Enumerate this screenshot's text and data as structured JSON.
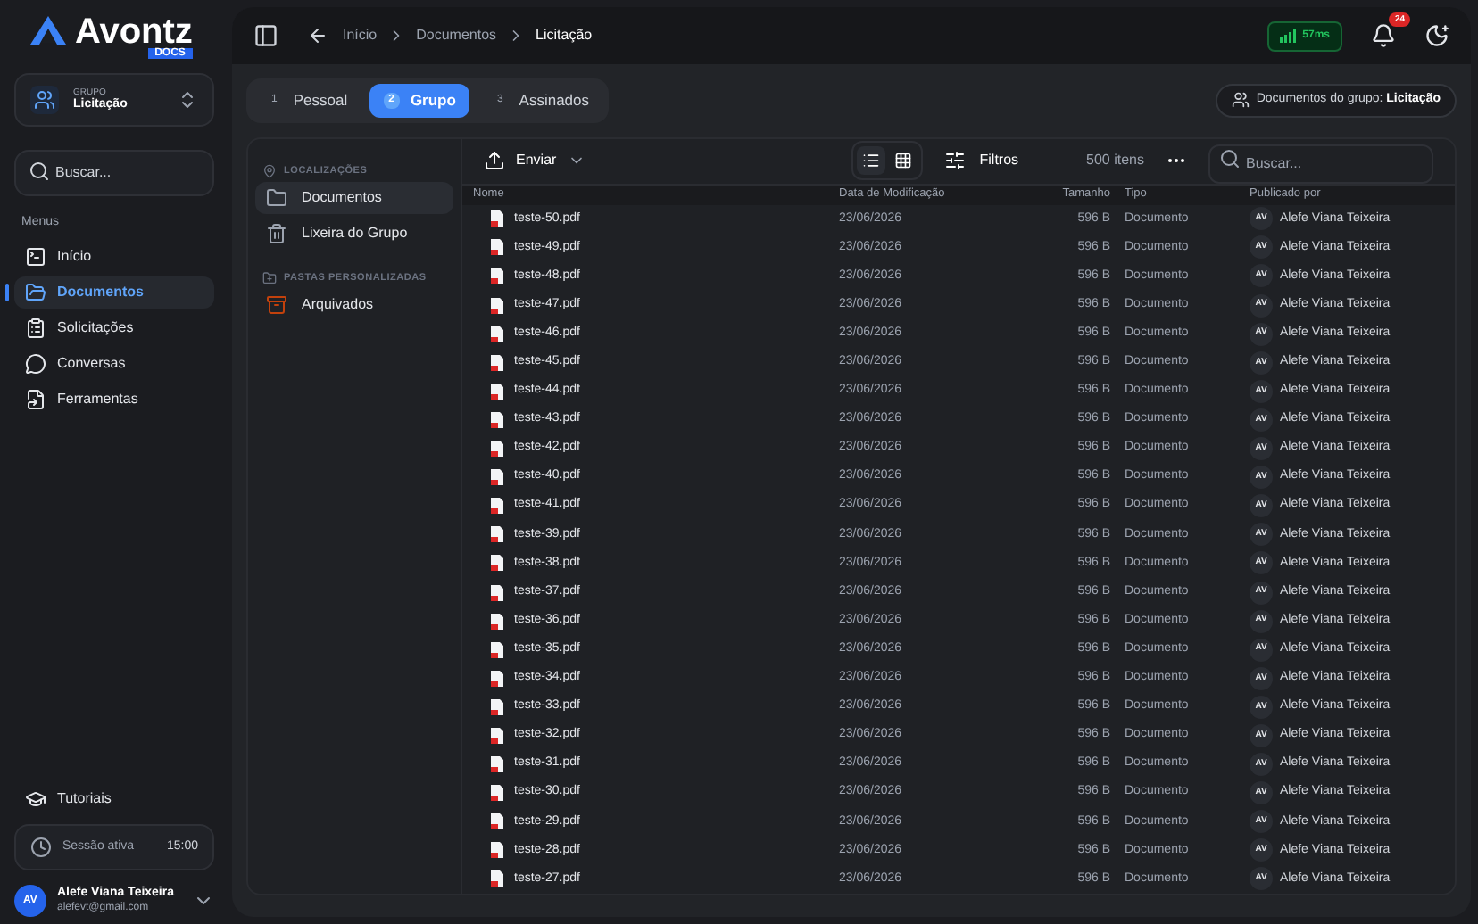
{
  "logo": {
    "name": "Avontz",
    "badge": "DOCS"
  },
  "group_switcher": {
    "caption": "GRUPO",
    "value": "Licitação"
  },
  "sidebar_search": {
    "placeholder": "Buscar..."
  },
  "menu_heading": "Menus",
  "menu": [
    {
      "label": "Início",
      "kind": "terminal",
      "selected": false
    },
    {
      "label": "Documentos",
      "kind": "folder",
      "selected": true
    },
    {
      "label": "Solicitações",
      "kind": "clipboard",
      "selected": false
    },
    {
      "label": "Conversas",
      "kind": "chat",
      "selected": false
    },
    {
      "label": "Ferramentas",
      "kind": "tool",
      "selected": false
    }
  ],
  "tutorials": "Tutoriais",
  "session": {
    "label": "Sessão ativa",
    "time": "15:00"
  },
  "user": {
    "initials": "AV",
    "name": "Alefe Viana Teixeira",
    "email": "alefevt@gmail.com"
  },
  "breadcrumbs": [
    "Início",
    "Documentos",
    "Licitação"
  ],
  "latency": "57ms",
  "notifications": "24",
  "tabs": [
    {
      "number": "1",
      "label": "Pessoal",
      "selected": false
    },
    {
      "number": "2",
      "label": "Grupo",
      "selected": true
    },
    {
      "number": "3",
      "label": "Assinados",
      "selected": false
    }
  ],
  "group_badge": {
    "label": "Documentos do grupo:",
    "value": "Licitação"
  },
  "locations": {
    "heading": "LOCALIZAÇÕES",
    "items": [
      {
        "label": "Documentos",
        "kind": "folder",
        "selected": true
      },
      {
        "label": "Lixeira do Grupo",
        "kind": "trash",
        "selected": false
      }
    ]
  },
  "custom_folders": {
    "heading": "PASTAS PERSONALIZADAS",
    "items": [
      {
        "label": "Arquivados",
        "kind": "archive",
        "selected": false
      }
    ]
  },
  "view_modes": [
    {
      "kind": "list",
      "selected": true
    },
    {
      "kind": "grid",
      "selected": false
    }
  ],
  "toolbar": {
    "upload": "Enviar",
    "filters": "Filtros",
    "count": "500 itens",
    "search_placeholder": "Buscar..."
  },
  "table": {
    "columns": [
      "Nome",
      "Data de Modificação",
      "Tamanho",
      "Tipo",
      "Publicado por"
    ],
    "rows": [
      [
        "teste-50.pdf",
        "23/06/2026",
        "596 B",
        "Documento",
        "AV",
        "Alefe Viana Teixeira"
      ],
      [
        "teste-49.pdf",
        "23/06/2026",
        "596 B",
        "Documento",
        "AV",
        "Alefe Viana Teixeira"
      ],
      [
        "teste-48.pdf",
        "23/06/2026",
        "596 B",
        "Documento",
        "AV",
        "Alefe Viana Teixeira"
      ],
      [
        "teste-47.pdf",
        "23/06/2026",
        "596 B",
        "Documento",
        "AV",
        "Alefe Viana Teixeira"
      ],
      [
        "teste-46.pdf",
        "23/06/2026",
        "596 B",
        "Documento",
        "AV",
        "Alefe Viana Teixeira"
      ],
      [
        "teste-45.pdf",
        "23/06/2026",
        "596 B",
        "Documento",
        "AV",
        "Alefe Viana Teixeira"
      ],
      [
        "teste-44.pdf",
        "23/06/2026",
        "596 B",
        "Documento",
        "AV",
        "Alefe Viana Teixeira"
      ],
      [
        "teste-43.pdf",
        "23/06/2026",
        "596 B",
        "Documento",
        "AV",
        "Alefe Viana Teixeira"
      ],
      [
        "teste-42.pdf",
        "23/06/2026",
        "596 B",
        "Documento",
        "AV",
        "Alefe Viana Teixeira"
      ],
      [
        "teste-40.pdf",
        "23/06/2026",
        "596 B",
        "Documento",
        "AV",
        "Alefe Viana Teixeira"
      ],
      [
        "teste-41.pdf",
        "23/06/2026",
        "596 B",
        "Documento",
        "AV",
        "Alefe Viana Teixeira"
      ],
      [
        "teste-39.pdf",
        "23/06/2026",
        "596 B",
        "Documento",
        "AV",
        "Alefe Viana Teixeira"
      ],
      [
        "teste-38.pdf",
        "23/06/2026",
        "596 B",
        "Documento",
        "AV",
        "Alefe Viana Teixeira"
      ],
      [
        "teste-37.pdf",
        "23/06/2026",
        "596 B",
        "Documento",
        "AV",
        "Alefe Viana Teixeira"
      ],
      [
        "teste-36.pdf",
        "23/06/2026",
        "596 B",
        "Documento",
        "AV",
        "Alefe Viana Teixeira"
      ],
      [
        "teste-35.pdf",
        "23/06/2026",
        "596 B",
        "Documento",
        "AV",
        "Alefe Viana Teixeira"
      ],
      [
        "teste-34.pdf",
        "23/06/2026",
        "596 B",
        "Documento",
        "AV",
        "Alefe Viana Teixeira"
      ],
      [
        "teste-33.pdf",
        "23/06/2026",
        "596 B",
        "Documento",
        "AV",
        "Alefe Viana Teixeira"
      ],
      [
        "teste-32.pdf",
        "23/06/2026",
        "596 B",
        "Documento",
        "AV",
        "Alefe Viana Teixeira"
      ],
      [
        "teste-31.pdf",
        "23/06/2026",
        "596 B",
        "Documento",
        "AV",
        "Alefe Viana Teixeira"
      ],
      [
        "teste-30.pdf",
        "23/06/2026",
        "596 B",
        "Documento",
        "AV",
        "Alefe Viana Teixeira"
      ],
      [
        "teste-29.pdf",
        "23/06/2026",
        "596 B",
        "Documento",
        "AV",
        "Alefe Viana Teixeira"
      ],
      [
        "teste-28.pdf",
        "23/06/2026",
        "596 B",
        "Documento",
        "AV",
        "Alefe Viana Teixeira"
      ],
      [
        "teste-27.pdf",
        "23/06/2026",
        "596 B",
        "Documento",
        "AV",
        "Alefe Viana Teixeira"
      ]
    ]
  }
}
